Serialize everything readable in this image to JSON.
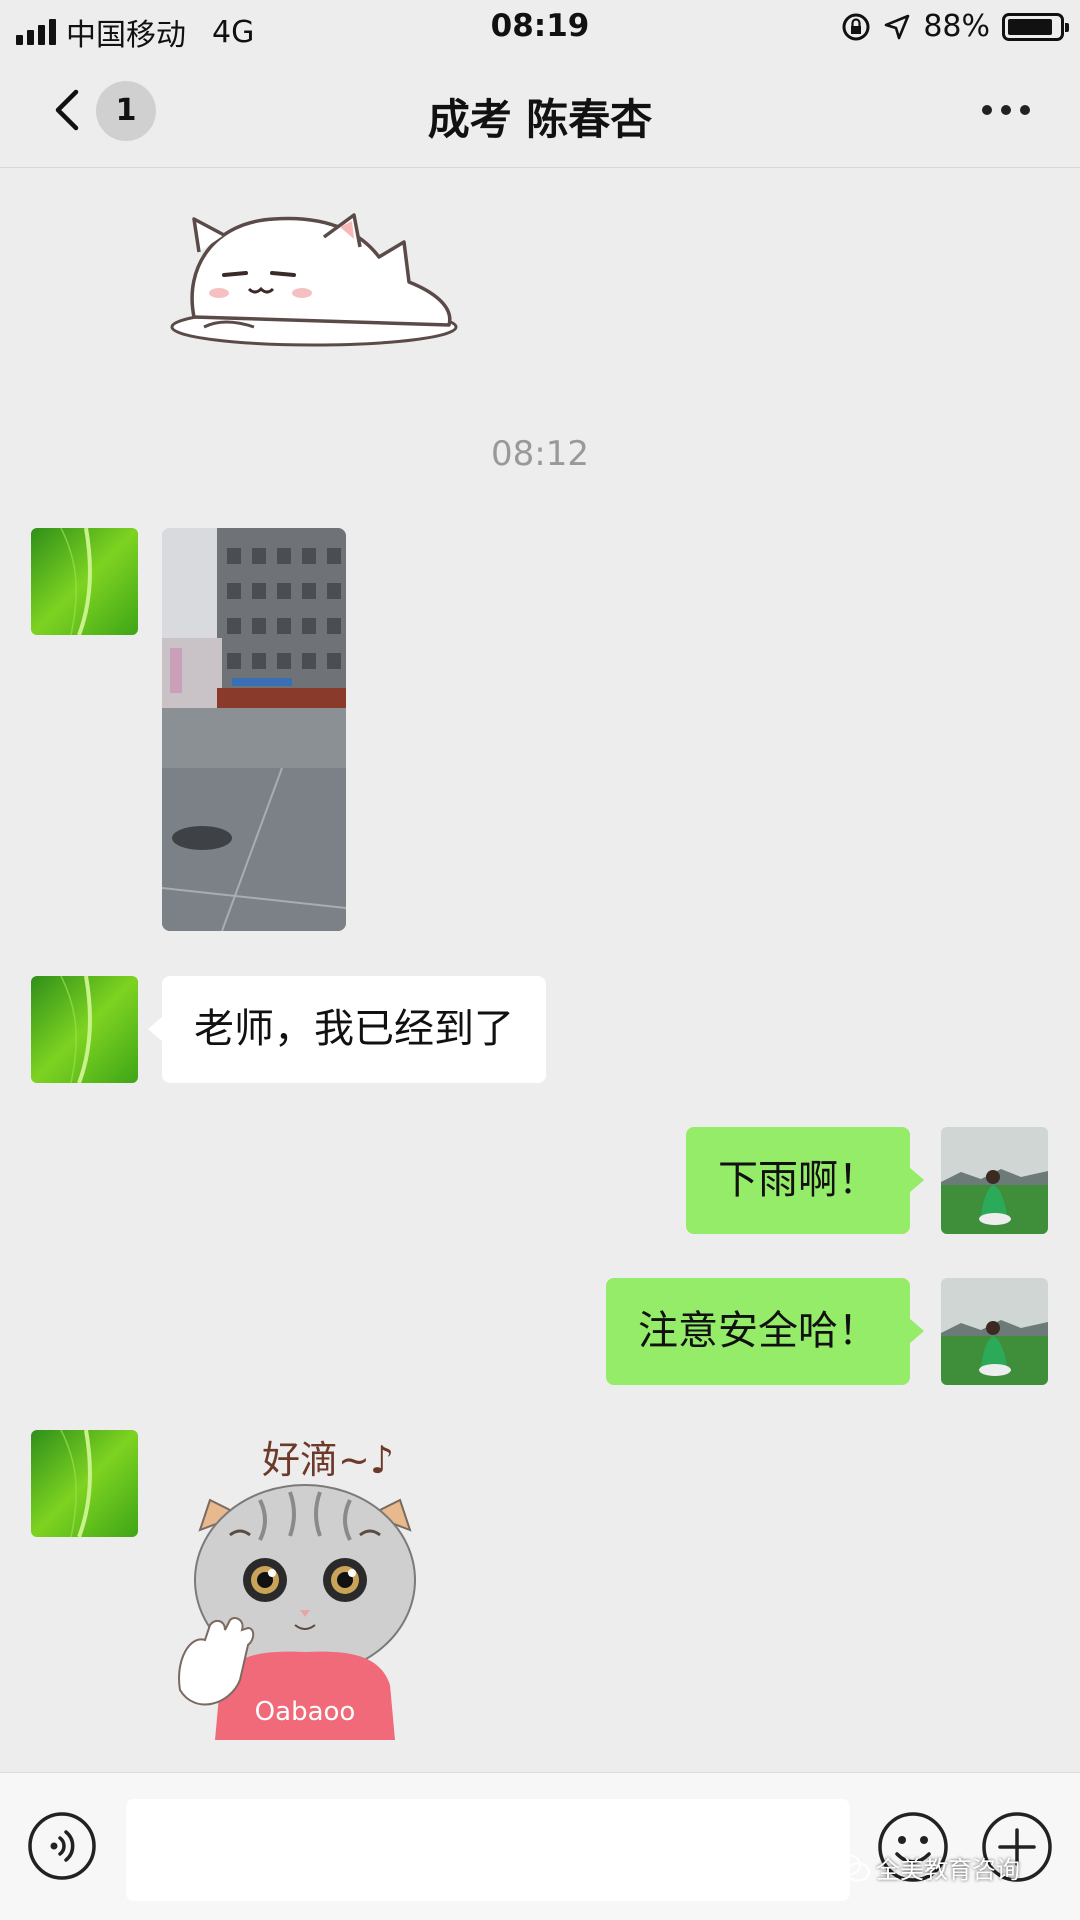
{
  "status_bar": {
    "carrier": "中国移动",
    "network": "4G",
    "time": "08:19",
    "battery": "88%",
    "battery_level": 0.88
  },
  "nav": {
    "unread_count": "1",
    "title": "成考 陈春杏"
  },
  "chat": {
    "timestamp": "08:12",
    "messages": [
      {
        "side": "left",
        "type": "sticker",
        "sticker": "sleeping-cat"
      },
      {
        "side": "left",
        "type": "photo",
        "photo": "rainy-plaza"
      },
      {
        "side": "left",
        "type": "text",
        "text": "老师，我已经到了"
      },
      {
        "side": "right",
        "type": "text",
        "text": "下雨啊！"
      },
      {
        "side": "right",
        "type": "text",
        "text": "注意安全哈！"
      },
      {
        "side": "left",
        "type": "sticker",
        "sticker": "cat-waving",
        "caption": "好滴~♪",
        "shirt_text": "Oabaoo"
      }
    ]
  },
  "input_bar": {
    "placeholder": ""
  },
  "watermark": "全美教育咨询",
  "colors": {
    "background": "#ededed",
    "sent_bubble": "#95ec69",
    "received_bubble": "#ffffff",
    "timestamp": "#999999"
  }
}
